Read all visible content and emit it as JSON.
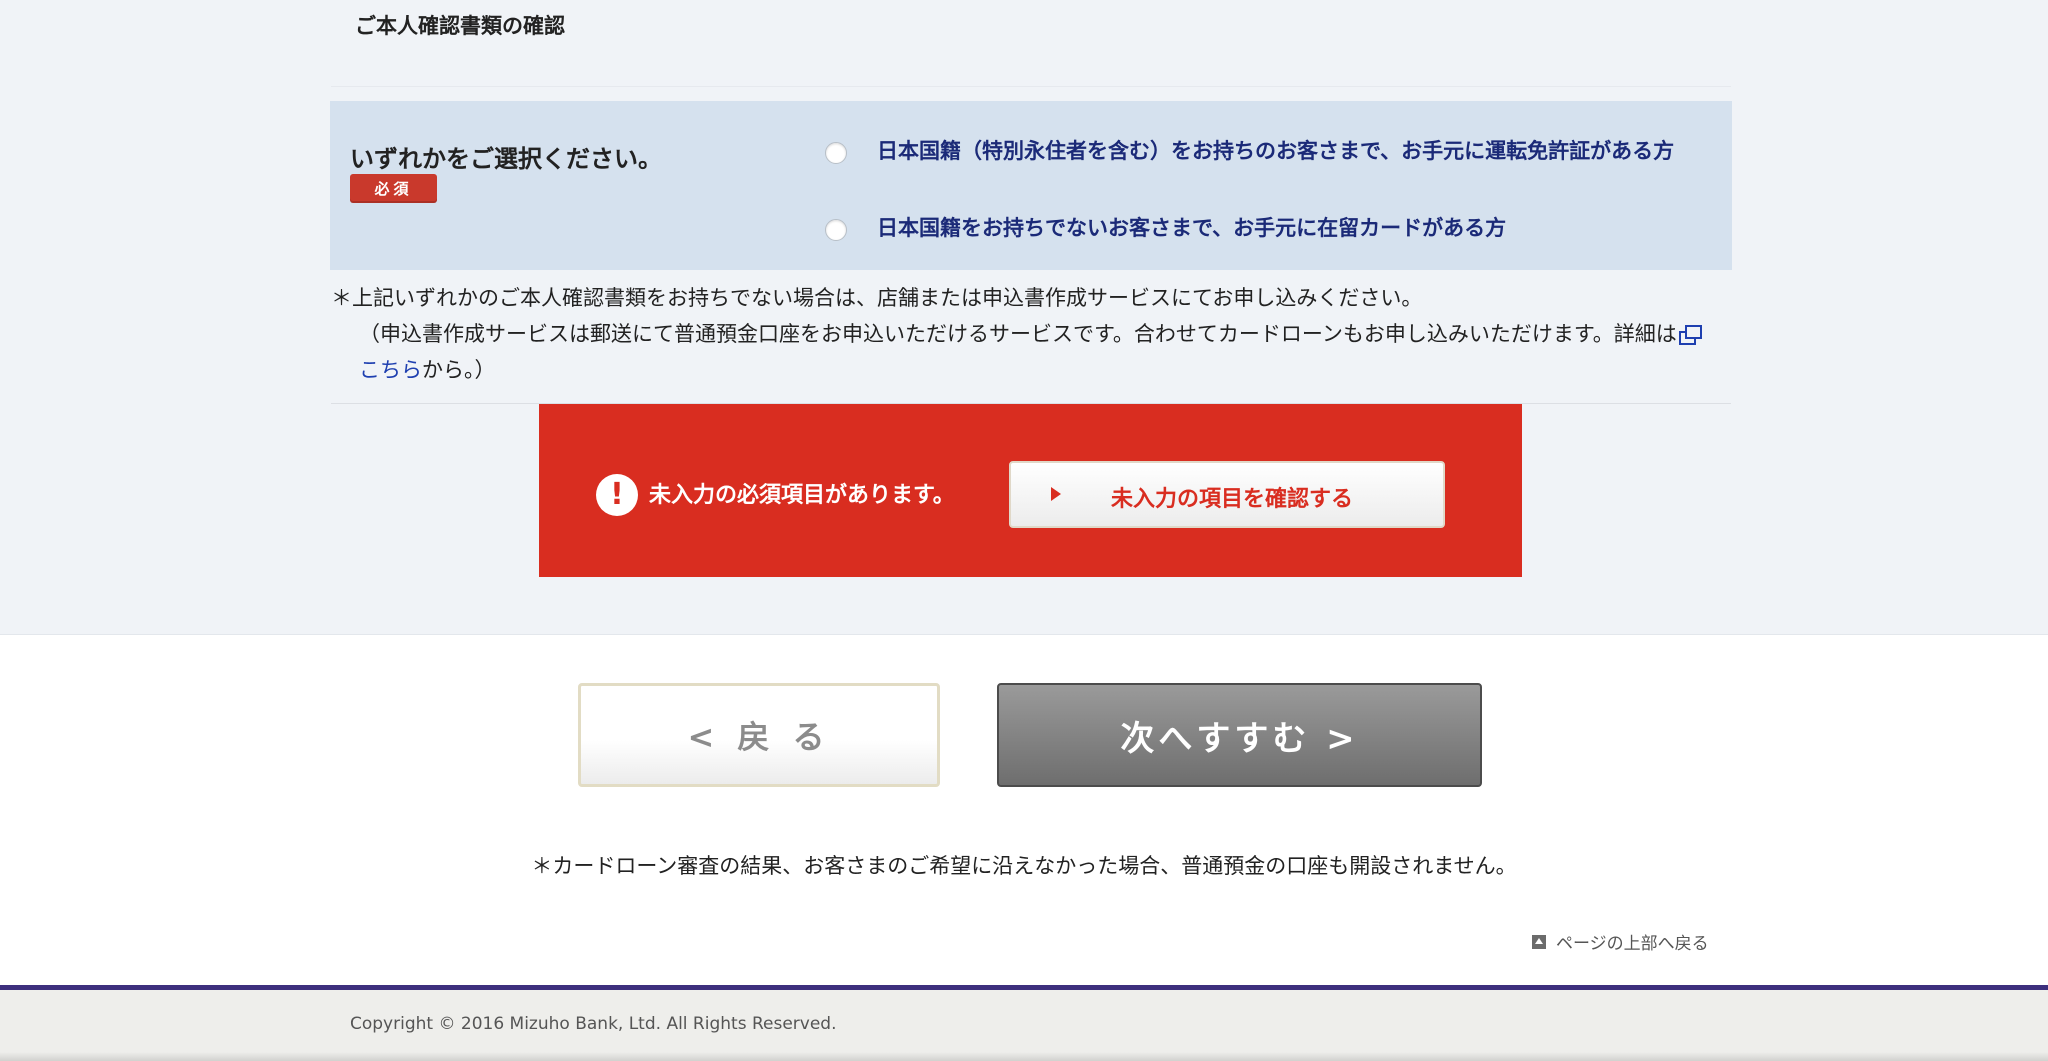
{
  "section": {
    "title": "ご本人確認書類の確認"
  },
  "selection": {
    "label": "いずれかをご選択ください。",
    "required_badge": "必須",
    "options": [
      {
        "label": "日本国籍（特別永住者を含む）をお持ちのお客さまで、お手元に運転免許証がある方",
        "selected": false
      },
      {
        "label": "日本国籍をお持ちでないお客さまで、お手元に在留カードがある方",
        "selected": false
      }
    ]
  },
  "notes": {
    "line1": "＊上記いずれかのご本人確認書類をお持ちでない場合は、店舗または申込書作成サービスにてお申し込みください。",
    "line2": "（申込書作成サービスは郵送にて普通預金口座をお申込いただけるサービスです。合わせてカードローンもお申し込みいただけます。詳細は",
    "link_text": "こちら",
    "line2_end": "から。）"
  },
  "error": {
    "icon": "exclamation-icon",
    "message": "未入力の必須項目があります。",
    "button_label": "未入力の項目を確認する",
    "color": "#d92d20"
  },
  "navigation": {
    "back_label": "< 戻 る",
    "next_label": "次へすすむ >"
  },
  "footnote": "＊カードローン審査の結果、お客さまのご希望に沿えなかった場合、普通預金の口座も開設されません。",
  "page_top_link": "ページの上部へ戻る",
  "footer": {
    "copyright": "Copyright © 2016 Mizuho Bank, Ltd. All Rights Reserved.",
    "accent_color": "#3d2f7d"
  }
}
